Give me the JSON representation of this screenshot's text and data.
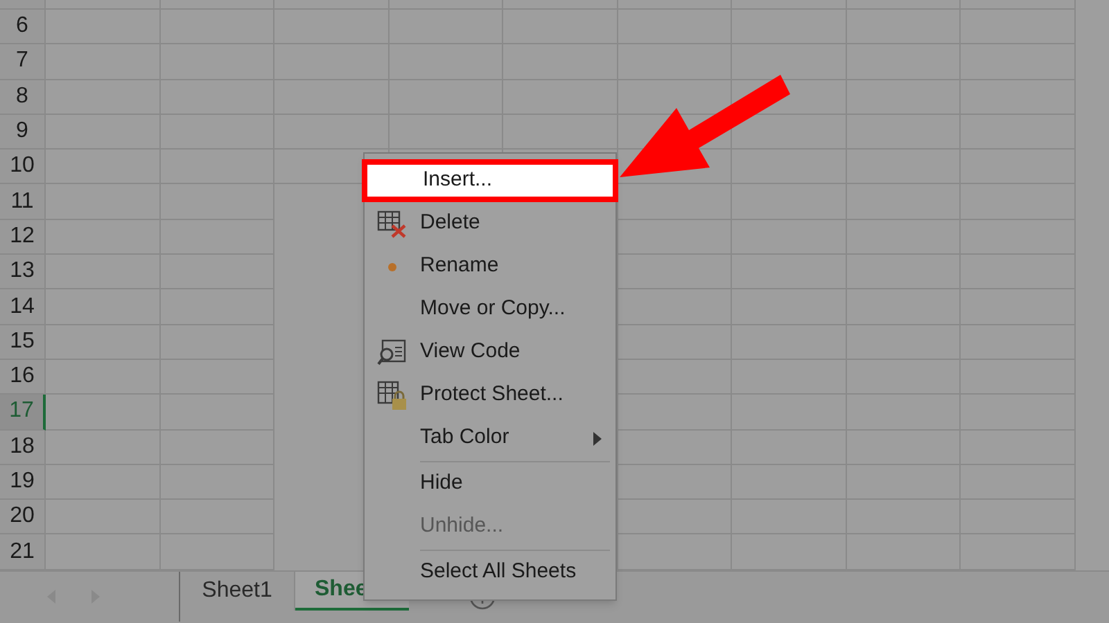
{
  "row_headers": [
    {
      "label": "6",
      "selected": false
    },
    {
      "label": "7",
      "selected": false
    },
    {
      "label": "8",
      "selected": false
    },
    {
      "label": "9",
      "selected": false
    },
    {
      "label": "10",
      "selected": false
    },
    {
      "label": "11",
      "selected": false
    },
    {
      "label": "12",
      "selected": false
    },
    {
      "label": "13",
      "selected": false
    },
    {
      "label": "14",
      "selected": false
    },
    {
      "label": "15",
      "selected": false
    },
    {
      "label": "16",
      "selected": false
    },
    {
      "label": "17",
      "selected": true
    },
    {
      "label": "18",
      "selected": false
    },
    {
      "label": "19",
      "selected": false
    },
    {
      "label": "20",
      "selected": false
    },
    {
      "label": "21",
      "selected": false
    }
  ],
  "sheet_tabs": [
    {
      "label": "Sheet1",
      "selected": false
    },
    {
      "label": "Shee",
      "selected": true
    }
  ],
  "context_menu": {
    "items": [
      {
        "kind": "plain",
        "label": "Insert...",
        "selected": true,
        "disabled": false
      },
      {
        "kind": "delete",
        "label": "Delete",
        "selected": false,
        "disabled": false
      },
      {
        "kind": "dot",
        "label": "Rename",
        "selected": false,
        "disabled": false
      },
      {
        "kind": "plain",
        "label": "Move or Copy...",
        "selected": false,
        "disabled": false
      },
      {
        "kind": "code",
        "label": "View Code",
        "selected": false,
        "disabled": false
      },
      {
        "kind": "lock",
        "label": "Protect Sheet...",
        "selected": false,
        "disabled": false
      },
      {
        "kind": "submenu",
        "label": "Tab Color",
        "selected": false,
        "disabled": false
      },
      {
        "kind": "separator"
      },
      {
        "kind": "plain",
        "label": "Hide",
        "selected": false,
        "disabled": false
      },
      {
        "kind": "plain",
        "label": "Unhide...",
        "selected": false,
        "disabled": true
      },
      {
        "kind": "separator"
      },
      {
        "kind": "plain",
        "label": "Select All Sheets",
        "selected": false,
        "disabled": false
      }
    ]
  }
}
